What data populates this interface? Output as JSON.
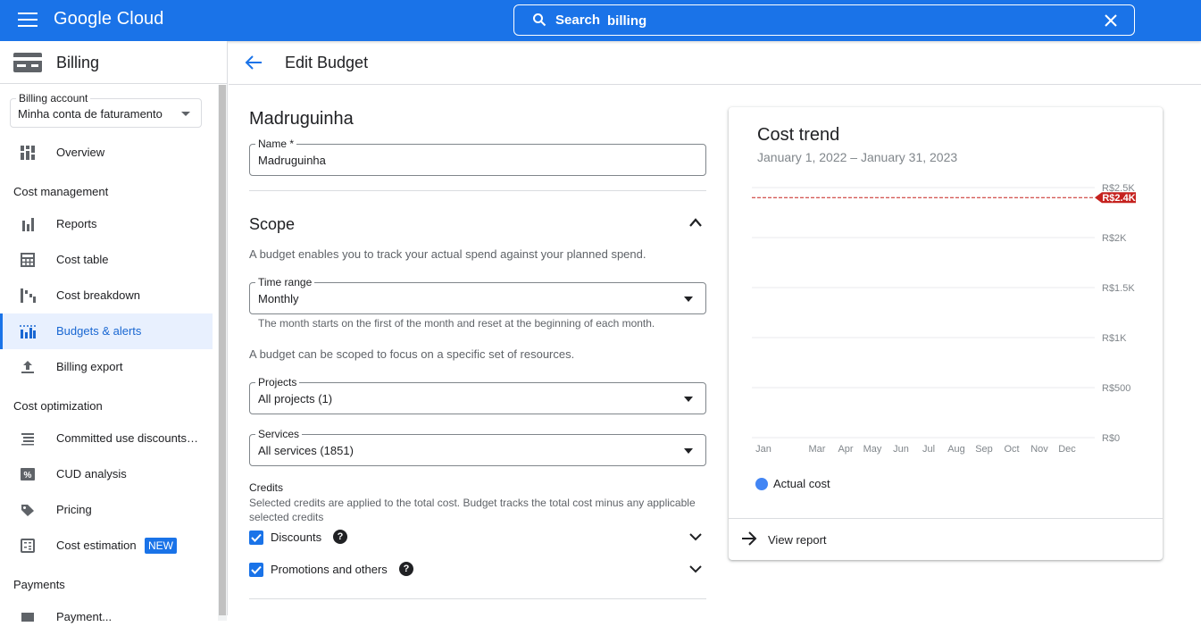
{
  "topbar": {
    "brand": "Google Cloud",
    "search_label": "Search",
    "search_value": "billing"
  },
  "sidebar": {
    "title": "Billing",
    "account_label": "Billing account",
    "account_value": "Minha conta de faturamento",
    "overview": "Overview",
    "section_cost_management": "Cost management",
    "reports": "Reports",
    "cost_table": "Cost table",
    "cost_breakdown": "Cost breakdown",
    "budgets_alerts": "Budgets & alerts",
    "billing_export": "Billing export",
    "section_cost_optimization": "Cost optimization",
    "committed_use": "Committed use discounts…",
    "cud_analysis": "CUD analysis",
    "pricing": "Pricing",
    "cost_estimation": "Cost estimation",
    "new_badge": "NEW",
    "section_payments": "Payments",
    "payment_partial": "Payment..."
  },
  "main": {
    "title": "Edit Budget",
    "budget_name": "Madruguinha",
    "name_label": "Name *",
    "name_value": "Madruguinha",
    "scope_title": "Scope",
    "scope_desc": "A budget enables you to track your actual spend against your planned spend.",
    "time_range_label": "Time range",
    "time_range_value": "Monthly",
    "time_range_hint": "The month starts on the first of the month and reset at the beginning of each month.",
    "scope_desc2": "A budget can be scoped to focus on a specific set of resources.",
    "projects_label": "Projects",
    "projects_value": "All projects (1)",
    "services_label": "Services",
    "services_value": "All services (1851)",
    "credits_title": "Credits",
    "credits_desc": "Selected credits are applied to the total cost. Budget tracks the total cost minus any applicable selected credits",
    "discounts": "Discounts",
    "promotions": "Promotions and others"
  },
  "card": {
    "title": "Cost trend",
    "date_range": "January 1, 2022 – January 31, 2023",
    "legend": "Actual cost",
    "view_report": "View report"
  },
  "chart_data": {
    "type": "line",
    "title": "Cost trend",
    "x": [
      "Jan",
      "Mar",
      "Apr",
      "May",
      "Jun",
      "Jul",
      "Aug",
      "Sep",
      "Oct",
      "Nov",
      "Dec"
    ],
    "y_ticks": [
      "R$0",
      "R$500",
      "R$1K",
      "R$1.5K",
      "R$2K",
      "R$2.5K"
    ],
    "ylim": [
      0,
      2500
    ],
    "budget_line": {
      "value": 2400,
      "label": "R$2.4K",
      "color": "#c5221f"
    },
    "series": [
      {
        "name": "Actual cost",
        "values": [],
        "color": "#4285f4"
      }
    ],
    "grid": true,
    "legend": "bottom-left"
  }
}
